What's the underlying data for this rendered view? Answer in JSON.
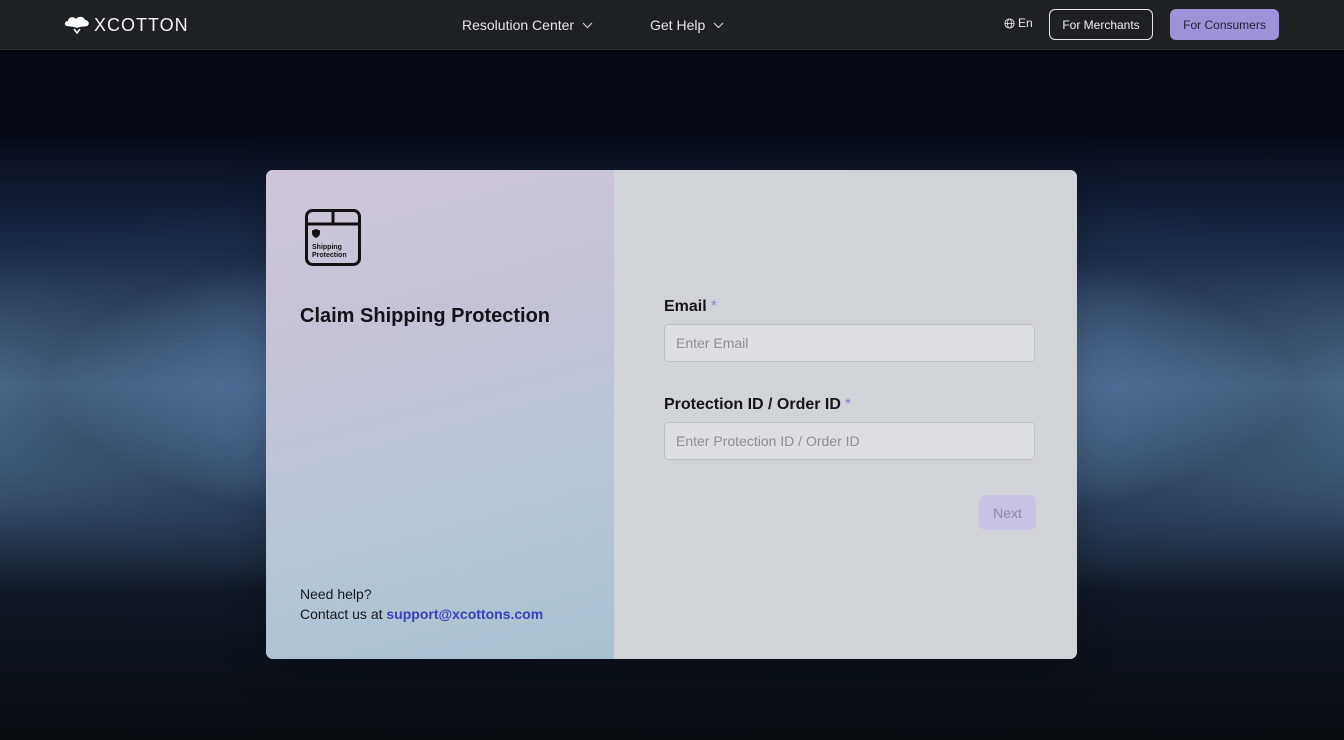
{
  "header": {
    "brand": "XCOTTON",
    "nav": [
      {
        "label": "Resolution Center"
      },
      {
        "label": "Get Help"
      }
    ],
    "language": "En",
    "merchants_button": "For Merchants",
    "consumers_button": "For Consumers"
  },
  "card": {
    "icon_text": [
      "Shipping",
      "Protection"
    ],
    "title": "Claim Shipping Protection",
    "help_prompt": "Need help?",
    "contact_prefix": "Contact us at",
    "contact_email": "support@xcottons.com",
    "form": {
      "email_label": "Email",
      "email_placeholder": "Enter Email",
      "pid_label": "Protection ID / Order ID",
      "pid_placeholder": "Enter Protection ID / Order ID",
      "required_mark": "*",
      "next_button": "Next"
    }
  },
  "colors": {
    "accent": "#9f92d9",
    "link": "#3a3fc0",
    "header_bg": "#1e2124"
  }
}
